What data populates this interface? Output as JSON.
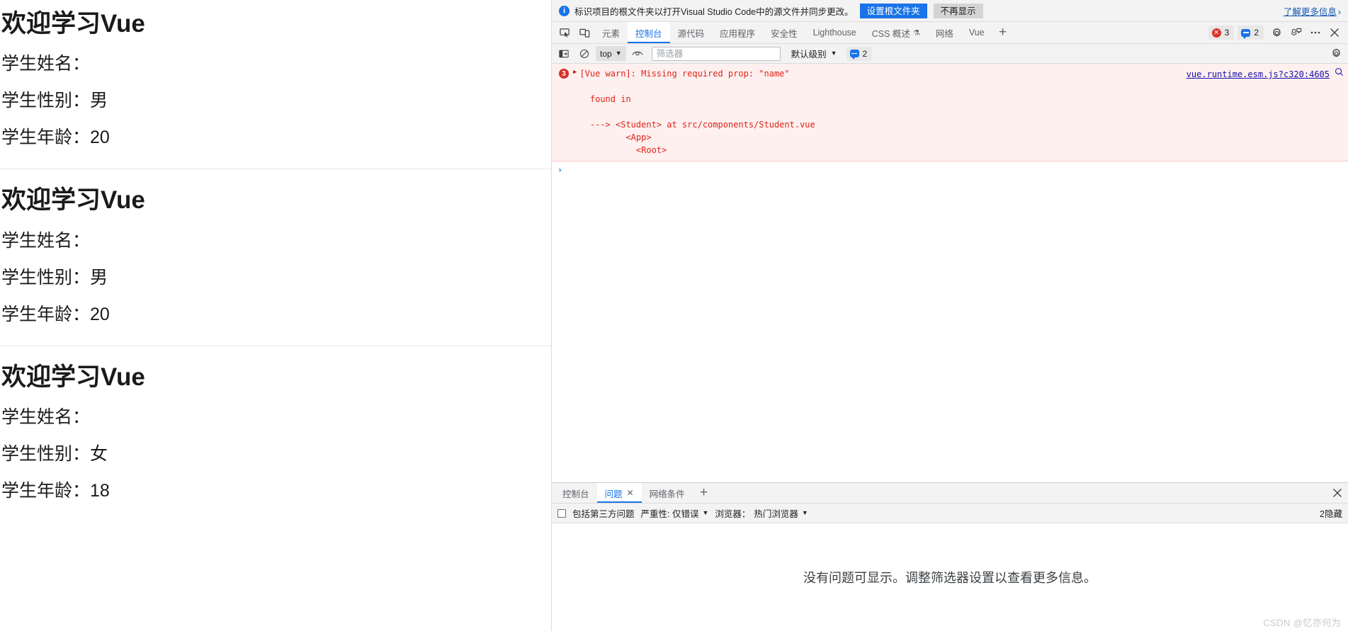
{
  "page": {
    "students": [
      {
        "title": "欢迎学习Vue",
        "name_label": "学生姓名：",
        "name_value": "",
        "gender_label": "学生性别：",
        "gender_value": "男",
        "age_label": "学生年龄：",
        "age_value": "20"
      },
      {
        "title": "欢迎学习Vue",
        "name_label": "学生姓名：",
        "name_value": "",
        "gender_label": "学生性别：",
        "gender_value": "男",
        "age_label": "学生年龄：",
        "age_value": "20"
      },
      {
        "title": "欢迎学习Vue",
        "name_label": "学生姓名：",
        "name_value": "",
        "gender_label": "学生性别：",
        "gender_value": "女",
        "age_label": "学生年龄：",
        "age_value": "18"
      }
    ]
  },
  "notification": {
    "icon": "info-icon",
    "text": "标识项目的根文件夹以打开Visual Studio Code中的源文件并同步更改。",
    "primary_button": "设置根文件夹",
    "secondary_button": "不再显示",
    "link": "了解更多信息",
    "link_chevron": "›",
    "primary_color": "#1a73e8"
  },
  "devtools": {
    "tools": [
      {
        "name": "inspect-element-icon"
      },
      {
        "name": "device-toolbar-icon"
      }
    ],
    "tabs": [
      {
        "label": "元素",
        "active": false,
        "experimental": false
      },
      {
        "label": "控制台",
        "active": true,
        "experimental": false
      },
      {
        "label": "源代码",
        "active": false,
        "experimental": false
      },
      {
        "label": "应用程序",
        "active": false,
        "experimental": false
      },
      {
        "label": "安全性",
        "active": false,
        "experimental": false
      },
      {
        "label": "Lighthouse",
        "active": false,
        "experimental": false
      },
      {
        "label": "CSS 概述",
        "active": false,
        "experimental": true
      },
      {
        "label": "网络",
        "active": false,
        "experimental": false
      },
      {
        "label": "Vue",
        "active": false,
        "experimental": false
      }
    ],
    "add_tab": "+",
    "error_count": "3",
    "message_count": "2",
    "header_icons": [
      {
        "name": "settings-gear-icon"
      },
      {
        "name": "feedback-icon"
      },
      {
        "name": "more-options-icon"
      },
      {
        "name": "close-devtools-icon"
      }
    ]
  },
  "console_toolbar": {
    "sidebar_toggle": "console-sidebar-icon",
    "clear": "clear-console-icon",
    "context": "top",
    "eye_icon": "live-expression-icon",
    "filter_placeholder": "筛选器",
    "filter_value": "",
    "level": "默认级别",
    "message_count": "2",
    "settings": "console-settings-icon"
  },
  "console": {
    "badge_count": "3",
    "expand_arrow": "▶",
    "message": "[Vue warn]: Missing required prop: \"name\"\n\n  found in\n\n  ---> <Student> at src/components/Student.vue\n         <App>\n           <Root>",
    "source_link": "vue.runtime.esm.js?c320:4605",
    "magnifier": "search-in-source-icon",
    "prompt": "›"
  },
  "drawer": {
    "tabs": [
      {
        "label": "控制台",
        "active": false,
        "closable": false
      },
      {
        "label": "问题",
        "active": true,
        "closable": true
      },
      {
        "label": "网络条件",
        "active": false,
        "closable": false
      }
    ],
    "close_glyph": "✕",
    "add_tab": "+",
    "close_drawer": "close-drawer-icon",
    "issues_bar": {
      "third_party_label": "包括第三方问题",
      "third_party_checked": false,
      "severity_label": "严重性: 仅错误",
      "browser_label": "浏览器：",
      "browser_value": "热门浏览器",
      "hidden_count": "2隐藏"
    },
    "empty_message": "没有问题可显示。调整筛选器设置以查看更多信息。"
  },
  "watermark": "CSDN @忆亦何为"
}
